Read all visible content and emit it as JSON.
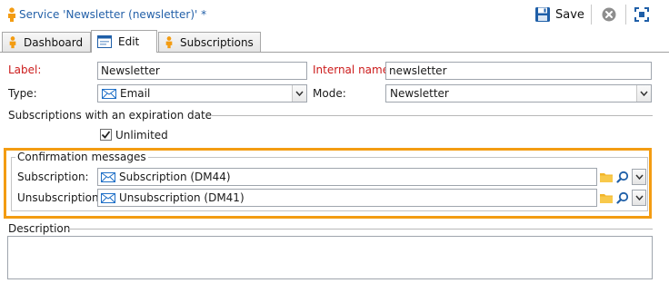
{
  "window": {
    "title": "Service 'Newsletter (newsletter)' *",
    "save_label": "Save",
    "title_icon": "person-icon",
    "close_icon": "close-icon",
    "maximize_icon": "maximize-icon"
  },
  "tabs": [
    {
      "label": "Dashboard",
      "icon": "person-icon",
      "active": false
    },
    {
      "label": "Edit",
      "icon": "form-window-icon",
      "active": true
    },
    {
      "label": "Subscriptions",
      "icon": "person-icon",
      "active": false
    }
  ],
  "form": {
    "label_caption": "Label:",
    "label_value": "Newsletter",
    "internal_name_caption": "Internal name:",
    "internal_name_value": "newsletter",
    "type_caption": "Type:",
    "type_value": "Email",
    "mode_caption": "Mode:",
    "mode_value": "Newsletter",
    "expiration_group": "Subscriptions with an expiration date",
    "unlimited_label": "Unlimited",
    "unlimited_checked": true,
    "confirmation_group": "Confirmation messages",
    "subscription_caption": "Subscription:",
    "subscription_value": "Subscription (DM44)",
    "unsubscription_caption": "Unsubscription:",
    "unsubscription_value": "Unsubscription (DM41)",
    "description_caption": "Description"
  },
  "colors": {
    "title_text": "#2360a8",
    "required_label": "#cc1b1b",
    "highlight_border": "#f39c12",
    "email_icon": "#1e6fc7"
  }
}
